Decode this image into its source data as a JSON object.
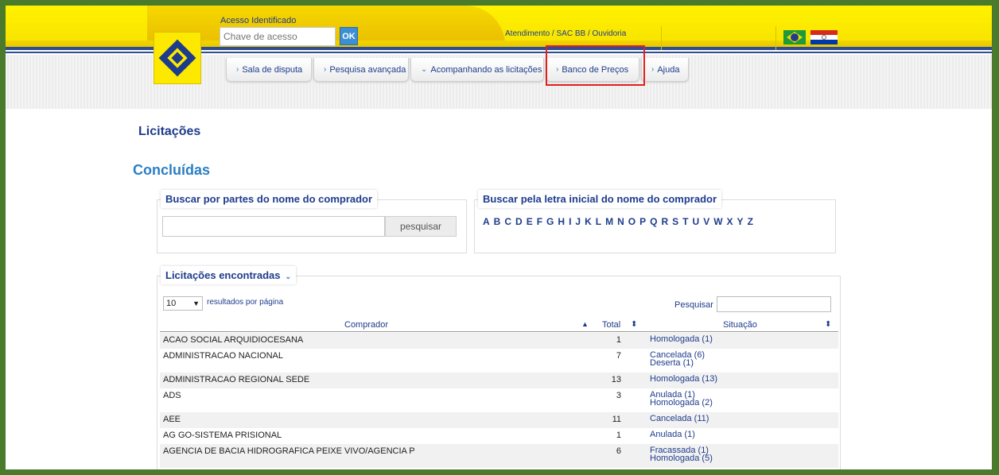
{
  "header": {
    "acesso_label": "Acesso Identificado",
    "chave_placeholder": "Chave de acesso",
    "ok_label": "OK",
    "atendimento": "Atendimento / SAC BB / Ouvidoria",
    "colors": {
      "yellow": "#fff200",
      "blue": "#1e3c8c"
    }
  },
  "nav": {
    "tabs": [
      {
        "label": "Sala de disputa",
        "icon": "chevron-right-icon"
      },
      {
        "label": "Pesquisa avançada",
        "icon": "chevron-right-icon"
      },
      {
        "label": "Acompanhando as licitações",
        "icon": "chevron-down-icon"
      },
      {
        "label": "Banco de Preços",
        "icon": "chevron-right-icon"
      },
      {
        "label": "Ajuda",
        "icon": "chevron-right-icon"
      }
    ],
    "highlight_color": "#e0201f"
  },
  "page": {
    "title": "Licitações",
    "section": "Concluídas"
  },
  "search_by_name": {
    "legend": "Buscar por partes do nome do comprador",
    "button": "pesquisar"
  },
  "search_by_letter": {
    "legend": "Buscar pela letra inicial do nome do comprador",
    "letters": [
      "A",
      "B",
      "C",
      "D",
      "E",
      "F",
      "G",
      "H",
      "I",
      "J",
      "K",
      "L",
      "M",
      "N",
      "O",
      "P",
      "Q",
      "R",
      "S",
      "T",
      "U",
      "V",
      "W",
      "X",
      "Y",
      "Z"
    ]
  },
  "results": {
    "legend": "Licitações encontradas",
    "page_length": "10",
    "page_length_label": "resultados por página",
    "search_label": "Pesquisar",
    "columns": [
      "Comprador",
      "Total",
      "Situação"
    ],
    "rows": [
      {
        "comprador": "ACAO SOCIAL ARQUIDIOCESANA",
        "total": "1",
        "situacao": [
          "Homologada (1)"
        ]
      },
      {
        "comprador": "ADMINISTRACAO NACIONAL",
        "total": "7",
        "situacao": [
          "Cancelada (6)",
          "Deserta (1)"
        ]
      },
      {
        "comprador": "ADMINISTRACAO REGIONAL SEDE",
        "total": "13",
        "situacao": [
          "Homologada (13)"
        ]
      },
      {
        "comprador": "ADS",
        "total": "3",
        "situacao": [
          "Anulada (1)",
          "Homologada (2)"
        ]
      },
      {
        "comprador": "AEE",
        "total": "11",
        "situacao": [
          "Cancelada (11)"
        ]
      },
      {
        "comprador": "AG GO-SISTEMA PRISIONAL",
        "total": "1",
        "situacao": [
          "Anulada (1)"
        ]
      },
      {
        "comprador": "AGENCIA DE BACIA HIDROGRAFICA PEIXE VIVO/AGENCIA P",
        "total": "6",
        "situacao": [
          "Fracassada (1)",
          "Homologada (5)"
        ]
      }
    ]
  }
}
